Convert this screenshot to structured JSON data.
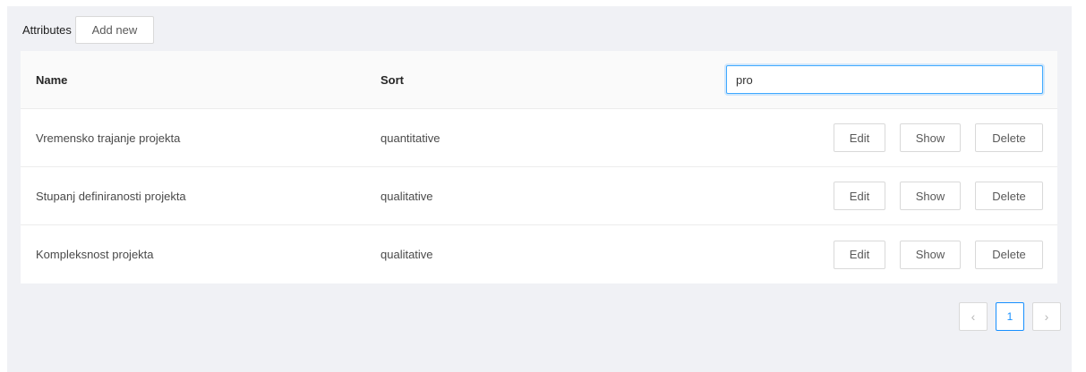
{
  "header": {
    "title": "Attributes",
    "add_label": "Add new"
  },
  "table": {
    "columns": {
      "name": "Name",
      "sort": "Sort"
    },
    "search": {
      "value": "pro",
      "placeholder": ""
    },
    "rows": [
      {
        "name": "Vremensko trajanje projekta",
        "sort": "quantitative"
      },
      {
        "name": "Stupanj definiranosti projekta",
        "sort": "qualitative"
      },
      {
        "name": "Kompleksnost projekta",
        "sort": "qualitative"
      }
    ],
    "actions": {
      "edit": "Edit",
      "show": "Show",
      "delete": "Delete"
    }
  },
  "pagination": {
    "prev_icon": "chevron-left-icon",
    "current_page": "1",
    "next_icon": "chevron-right-icon",
    "active_color": "#1890ff"
  }
}
